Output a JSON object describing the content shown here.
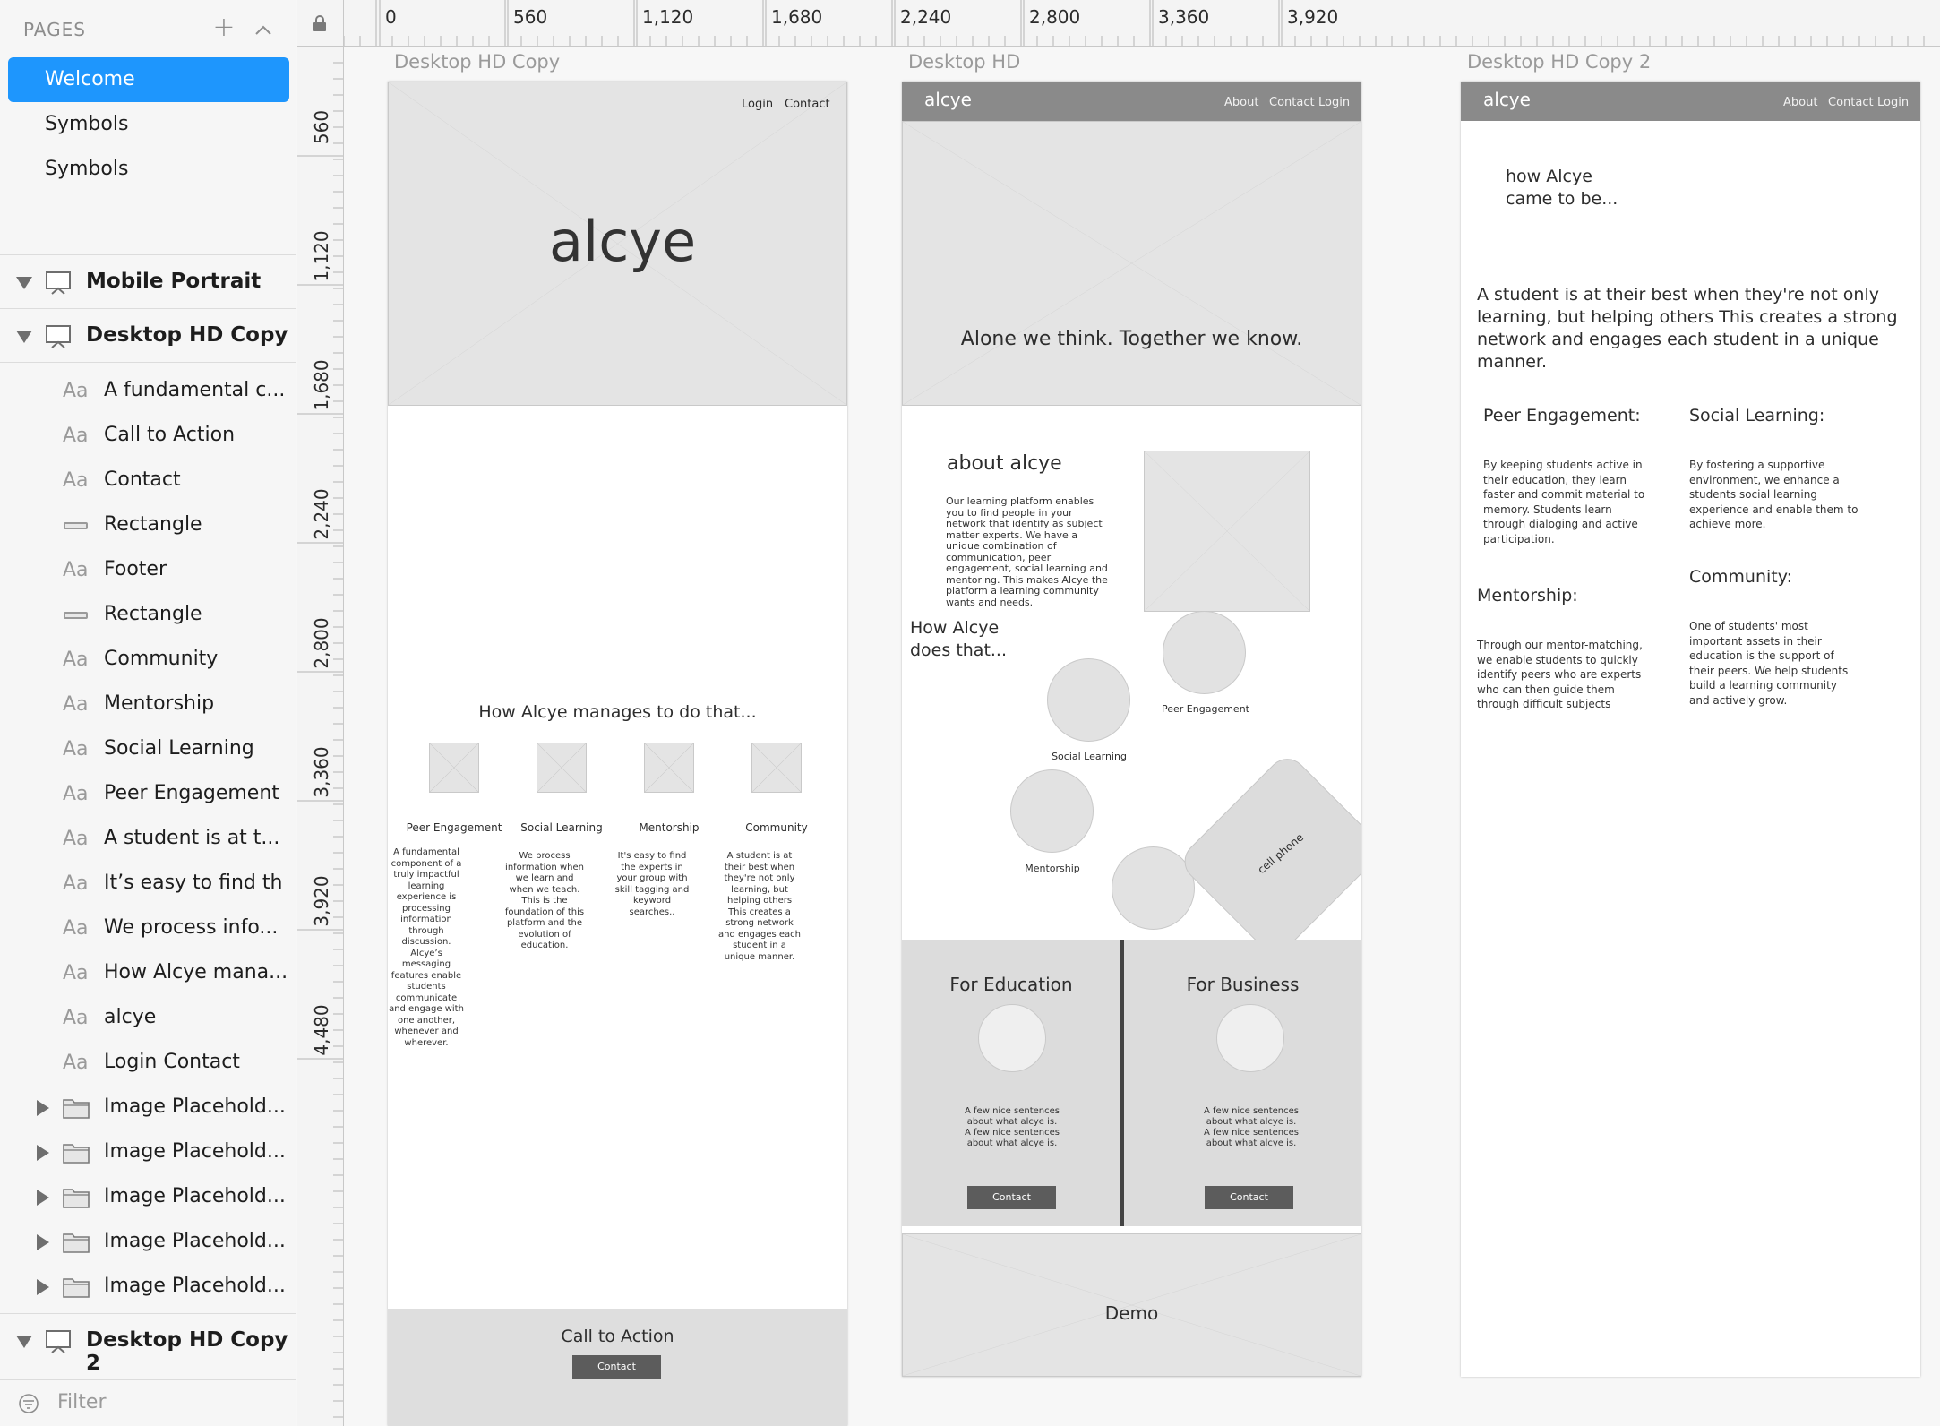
{
  "sidebar": {
    "pages_title": "PAGES",
    "pages": [
      "Welcome",
      "Symbols",
      "Symbols"
    ],
    "groups": {
      "mobile_portrait": "Mobile Portrait",
      "desktop_hd_copy": "Desktop HD Copy",
      "desktop_hd_copy_2": "Desktop HD Copy 2"
    },
    "layers": [
      {
        "icon": "Aa",
        "label": "A fundamental c..."
      },
      {
        "icon": "Aa",
        "label": "Call to Action"
      },
      {
        "icon": "Aa",
        "label": "Contact"
      },
      {
        "icon": "rect",
        "label": "Rectangle"
      },
      {
        "icon": "Aa",
        "label": "Footer"
      },
      {
        "icon": "rect",
        "label": "Rectangle"
      },
      {
        "icon": "Aa",
        "label": "Community"
      },
      {
        "icon": "Aa",
        "label": "Mentorship"
      },
      {
        "icon": "Aa",
        "label": "Social Learning"
      },
      {
        "icon": "Aa",
        "label": "Peer Engagement"
      },
      {
        "icon": "Aa",
        "label": "A student is at t..."
      },
      {
        "icon": "Aa",
        "label": "It’s easy to find th"
      },
      {
        "icon": "Aa",
        "label": "We process info..."
      },
      {
        "icon": "Aa",
        "label": "How Alcye mana..."
      },
      {
        "icon": "Aa",
        "label": "alcye"
      },
      {
        "icon": "Aa",
        "label": "Login Contact"
      }
    ],
    "folders": [
      "Image Placehold...",
      "Image Placehold...",
      "Image Placehold...",
      "Image Placehold...",
      "Image Placehold..."
    ],
    "filter_placeholder": "Filter"
  },
  "rulers": {
    "horizontal": [
      "0",
      "560",
      "1,120",
      "1,680",
      "2,240",
      "2,800",
      "3,360",
      "3,920"
    ],
    "vertical": [
      "560",
      "1,120",
      "1,680",
      "2,240",
      "2,800",
      "3,360",
      "3,920",
      "4,480"
    ]
  },
  "artboard1": {
    "title": "Desktop HD Copy",
    "nav_login": "Login",
    "nav_contact": "Contact",
    "brand": "alcye",
    "heading": "How Alcye manages to do that...",
    "features": [
      {
        "title": "Peer Engagement",
        "text": "A fundamental component of a truly impactful learning experience is processing information through discussion. Alcye’s messaging features enable students communicate and engage with one another, whenever and wherever."
      },
      {
        "title": "Social Learning",
        "text": "We process information when we learn and when we teach. This is the foundation of this platform and the evolution of education."
      },
      {
        "title": "Mentorship",
        "text": "It's easy to find the experts in your group with skill tagging and keyword searches.."
      },
      {
        "title": "Community",
        "text": "A student is at their best when they're not only learning, but helping others This creates a strong network and engages each student in a unique manner."
      }
    ],
    "cta_title": "Call to Action",
    "cta_button": "Contact"
  },
  "artboard2": {
    "title": "Desktop HD",
    "brand": "alcye",
    "nav": [
      "About",
      "Contact",
      "Login"
    ],
    "tagline": "Alone we think. Together we know.",
    "about_title": "about alcye",
    "about_text": "Our learning platform enables you to find people in your network that identify as subject matter experts. We have a unique combination of communication, peer engagement, social learning and mentoring. This makes Alcye the platform a learning community wants and needs.",
    "how_title": "How Alcye does that...",
    "bubbles": [
      "Peer Engagement",
      "Social Learning",
      "Mentorship"
    ],
    "phone_label": "cell phone",
    "for_education": "For Education",
    "for_business": "For Business",
    "few_sentences": "A few nice sentences about what alcye is. A few nice sentences about what alcye is.",
    "contact_button": "Contact",
    "demo": "Demo"
  },
  "artboard3": {
    "title": "Desktop HD Copy 2",
    "brand": "alcye",
    "nav": [
      "About",
      "Contact",
      "Login"
    ],
    "intro": "how Alcye came to be...",
    "lead": "A student is at their best when they're not only learning, but helping others This creates a strong network and engages each student in a unique manner.",
    "peer_title": "Peer Engagement:",
    "peer_text": "By keeping students active in their education, they learn faster and commit material to memory. Students learn through dialoging and active participation.",
    "social_title": "Social Learning:",
    "social_text": "By fostering a supportive environment, we enhance a students social learning experience and enable them to achieve more.",
    "mentor_title": "Mentorship:",
    "mentor_text": "Through our mentor-matching, we enable students to quickly identify peers who are experts who can then guide them through difficult subjects",
    "community_title": "Community:",
    "community_text": "One of students' most important assets in their education is the support of their peers. We help students build a learning community and actively grow."
  },
  "colors": {
    "selection": "#1e96fd",
    "wire_gray": "#e4e4e4",
    "header_gray": "#8a8a8a",
    "button": "#5c5c5c"
  }
}
